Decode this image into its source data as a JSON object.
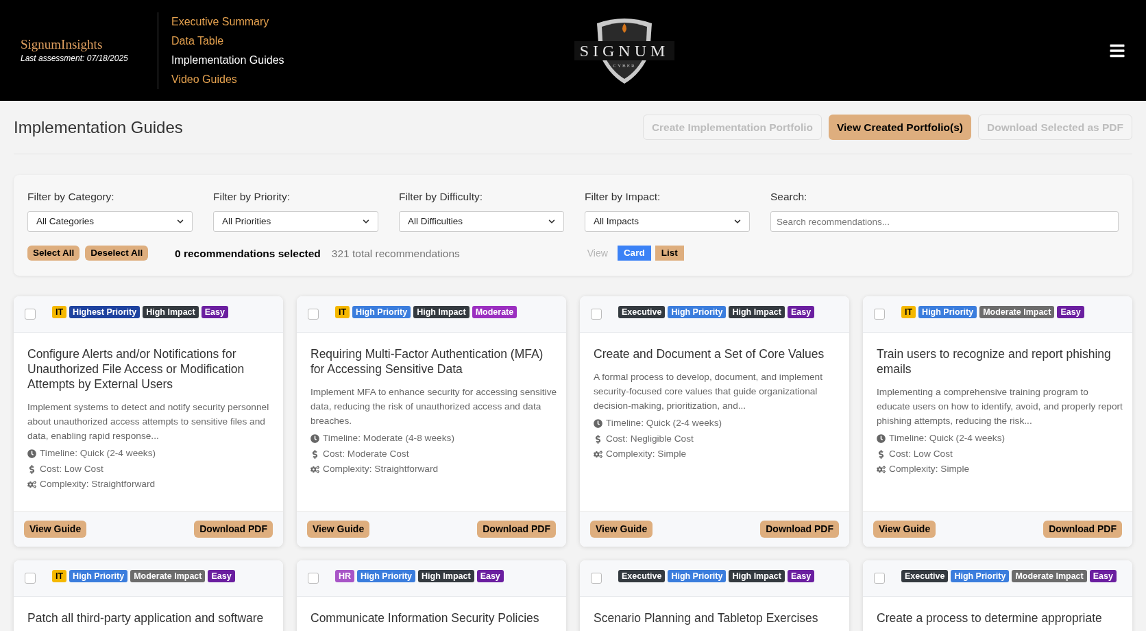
{
  "header": {
    "brand": "SignumInsights",
    "last_assessment": "Last assessment: 07/18/2025",
    "nav": [
      {
        "label": "Executive Summary",
        "selected": false
      },
      {
        "label": "Data Table",
        "selected": false
      },
      {
        "label": "Implementation Guides",
        "selected": true
      },
      {
        "label": "Video Guides",
        "selected": false
      }
    ],
    "logo": {
      "name": "SIGNUM",
      "tagline": "CYBER"
    }
  },
  "page_title": "Implementation Guides",
  "actions": [
    {
      "label": "Create Implementation Portfolio",
      "disabled": true
    },
    {
      "label": "View Created Portfolio(s)",
      "disabled": false
    },
    {
      "label": "Download Selected as PDF",
      "disabled": true
    }
  ],
  "filters": [
    {
      "label": "Filter by Category:",
      "kind": "select",
      "value": "All Categories"
    },
    {
      "label": "Filter by Priority:",
      "kind": "select",
      "value": "All Priorities"
    },
    {
      "label": "Filter by Difficulty:",
      "kind": "select",
      "value": "All Difficulties"
    },
    {
      "label": "Filter by Impact:",
      "kind": "select",
      "value": "All Impacts"
    },
    {
      "label": "Search:",
      "kind": "search",
      "placeholder": "Search recommendations..."
    }
  ],
  "selection_buttons": [
    "Select All",
    "Deselect All"
  ],
  "selected_count": "0 recommendations selected",
  "total_count": "321 total recommendations",
  "view_label": "View",
  "view_modes": [
    {
      "label": "Card",
      "selected": true
    },
    {
      "label": "List",
      "selected": false
    }
  ],
  "cards": [
    {
      "checked": false,
      "tags": [
        {
          "label": "IT",
          "color": "#f5b800"
        },
        {
          "label": "Highest Priority",
          "color": "#1e429f"
        },
        {
          "label": "High Impact",
          "color": "#343a40"
        },
        {
          "label": "Easy",
          "color": "#6b1fa0"
        }
      ],
      "title": "Configure Alerts and/or Notifications for Unauthorized File Access or Modification Attempts by External Users",
      "description": "Implement systems to detect and notify security personnel about unauthorized access attempts to sensitive files and data, enabling rapid response...",
      "details": [
        {
          "kind": "timeline",
          "text": "Timeline: Quick (2-4 weeks)"
        },
        {
          "kind": "cost",
          "text": "Cost: Low Cost"
        },
        {
          "kind": "complexity",
          "text": "Complexity: Straightforward"
        }
      ],
      "buttons": [
        "View Guide",
        "Download PDF"
      ]
    },
    {
      "checked": false,
      "tags": [
        {
          "label": "IT",
          "color": "#f5b800"
        },
        {
          "label": "High Priority",
          "color": "#3b7ddd"
        },
        {
          "label": "High Impact",
          "color": "#343a40"
        },
        {
          "label": "Moderate",
          "color": "#9b2fc0"
        }
      ],
      "title": "Requiring Multi-Factor Authentication (MFA) for Accessing Sensitive Data",
      "description": "Implement MFA to enhance security for accessing sensitive data, reducing the risk of unauthorized access and data breaches.",
      "details": [
        {
          "kind": "timeline",
          "text": "Timeline: Moderate (4-8 weeks)"
        },
        {
          "kind": "cost",
          "text": "Cost: Moderate Cost"
        },
        {
          "kind": "complexity",
          "text": "Complexity: Straightforward"
        }
      ],
      "buttons": [
        "View Guide",
        "Download PDF"
      ]
    },
    {
      "checked": false,
      "tags": [
        {
          "label": "Executive",
          "color": "#343a40"
        },
        {
          "label": "High Priority",
          "color": "#3b7ddd"
        },
        {
          "label": "High Impact",
          "color": "#343a40"
        },
        {
          "label": "Easy",
          "color": "#6b1fa0"
        }
      ],
      "title": "Create and Document a Set of Core Values",
      "description": "A formal process to develop, document, and implement security-focused core values that guide organizational decision-making, prioritization, and...",
      "details": [
        {
          "kind": "timeline",
          "text": "Timeline: Quick (2-4 weeks)"
        },
        {
          "kind": "cost",
          "text": "Cost: Negligible Cost"
        },
        {
          "kind": "complexity",
          "text": "Complexity: Simple"
        }
      ],
      "buttons": [
        "View Guide",
        "Download PDF"
      ]
    },
    {
      "checked": false,
      "tags": [
        {
          "label": "IT",
          "color": "#f5b800"
        },
        {
          "label": "High Priority",
          "color": "#3b7ddd"
        },
        {
          "label": "Moderate Impact",
          "color": "#6c6c6c"
        },
        {
          "label": "Easy",
          "color": "#6b1fa0"
        }
      ],
      "title": "Train users to recognize and report phishing emails",
      "description": "Implementing a comprehensive training program to educate users on how to identify, avoid, and properly report phishing attempts, reducing the risk...",
      "details": [
        {
          "kind": "timeline",
          "text": "Timeline: Quick (2-4 weeks)"
        },
        {
          "kind": "cost",
          "text": "Cost: Low Cost"
        },
        {
          "kind": "complexity",
          "text": "Complexity: Simple"
        }
      ],
      "buttons": [
        "View Guide",
        "Download PDF"
      ]
    },
    {
      "checked": false,
      "tags": [
        {
          "label": "IT",
          "color": "#f5b800"
        },
        {
          "label": "High Priority",
          "color": "#3b7ddd"
        },
        {
          "label": "Moderate Impact",
          "color": "#6c6c6c"
        },
        {
          "label": "Easy",
          "color": "#6b1fa0"
        }
      ],
      "title": "Patch all third-party application and software"
    },
    {
      "checked": false,
      "tags": [
        {
          "label": "HR",
          "color": "#a855c7"
        },
        {
          "label": "High Priority",
          "color": "#3b7ddd"
        },
        {
          "label": "High Impact",
          "color": "#343a40"
        },
        {
          "label": "Easy",
          "color": "#6b1fa0"
        }
      ],
      "title": "Communicate Information Security Policies"
    },
    {
      "checked": false,
      "tags": [
        {
          "label": "Executive",
          "color": "#343a40"
        },
        {
          "label": "High Priority",
          "color": "#3b7ddd"
        },
        {
          "label": "High Impact",
          "color": "#343a40"
        },
        {
          "label": "Easy",
          "color": "#6b1fa0"
        }
      ],
      "title": "Scenario Planning and Tabletop Exercises"
    },
    {
      "checked": false,
      "tags": [
        {
          "label": "Executive",
          "color": "#343a40"
        },
        {
          "label": "High Priority",
          "color": "#3b7ddd"
        },
        {
          "label": "Moderate Impact",
          "color": "#6c6c6c"
        },
        {
          "label": "Easy",
          "color": "#6b1fa0"
        }
      ],
      "title": "Create a process to determine appropriate"
    }
  ]
}
